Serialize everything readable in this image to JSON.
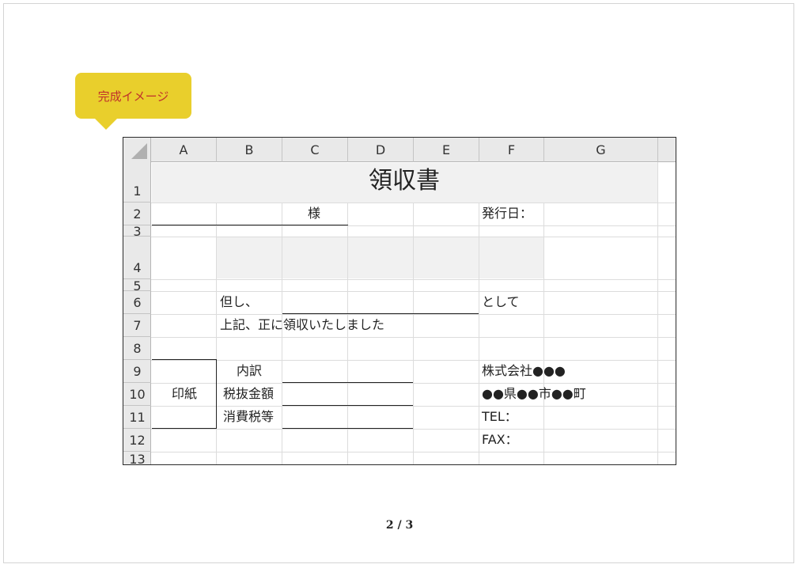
{
  "callout": {
    "label": "完成イメージ",
    "color": "#e9cf2c",
    "text_color": "#c0312b"
  },
  "sheet": {
    "columns": [
      "A",
      "B",
      "C",
      "D",
      "E",
      "F",
      "G"
    ],
    "rows": [
      "1",
      "2",
      "3",
      "4",
      "5",
      "6",
      "7",
      "8",
      "9",
      "10",
      "11",
      "12",
      "13"
    ],
    "title": "領収書",
    "sama": "様",
    "issue_date_label": "発行日：",
    "tadashi": "但し、",
    "toshite": "として",
    "received_text": "上記、正に領収いたしました",
    "breakdown_label": "内訳",
    "pretax_label": "税抜金額",
    "tax_label": "消費税等",
    "stamp_label": "印紙",
    "company": "株式会社●●●",
    "address": "●●県●●市●●町",
    "tel": "TEL：",
    "fax": "FAX："
  },
  "pager": {
    "current": "2",
    "separator": "/",
    "total": "3"
  }
}
